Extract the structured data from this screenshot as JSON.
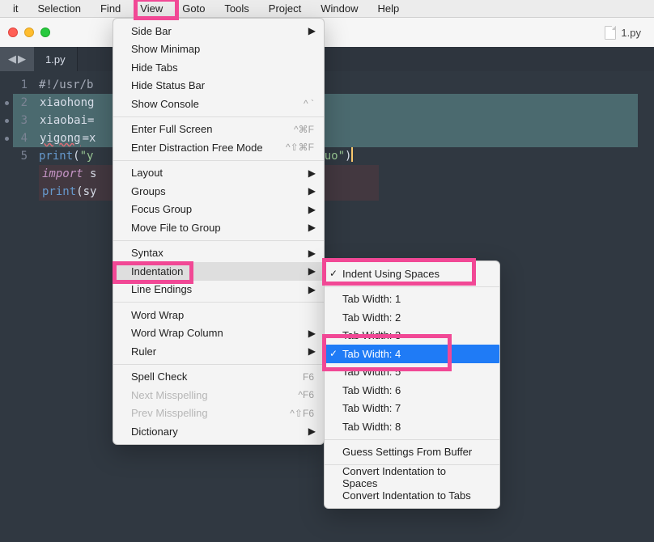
{
  "menubar": {
    "items": [
      "it",
      "Selection",
      "Find",
      "View",
      "Goto",
      "Tools",
      "Project",
      "Window",
      "Help"
    ]
  },
  "window": {
    "filename": "1.py",
    "tab_label": "1.py"
  },
  "editor": {
    "gutter": [
      "1",
      "2",
      "3",
      "4",
      "5"
    ],
    "lines": {
      "l1": "#!/usr/b",
      "l2": "xiaohong",
      "l3": "xiaobai=",
      "l4_a": "yigong",
      "l4_b": "=x",
      "l5_fn": "print",
      "l5_open": "(",
      "l5_str_a": "\"y",
      "l5_str_b": "ngguo\"",
      "l5_close": ")",
      "l6_kw": "import",
      "l6_rest": " s",
      "l7_fn": "print",
      "l7_open": "(",
      "l7_id": "sy"
    }
  },
  "view_menu": {
    "side_bar": "Side Bar",
    "show_minimap": "Show Minimap",
    "hide_tabs": "Hide Tabs",
    "hide_status_bar": "Hide Status Bar",
    "show_console": "Show Console",
    "show_console_kbd": "^ `",
    "enter_full": "Enter Full Screen",
    "enter_full_kbd": "^⌘F",
    "enter_distraction": "Enter Distraction Free Mode",
    "enter_distraction_kbd": "^⇧⌘F",
    "layout": "Layout",
    "groups": "Groups",
    "focus_group": "Focus Group",
    "move_file": "Move File to Group",
    "syntax": "Syntax",
    "indentation": "Indentation",
    "line_endings": "Line Endings",
    "word_wrap": "Word Wrap",
    "word_wrap_col": "Word Wrap Column",
    "ruler": "Ruler",
    "spell_check": "Spell Check",
    "spell_check_kbd": "F6",
    "next_misspell": "Next Misspelling",
    "next_misspell_kbd": "^F6",
    "prev_misspell": "Prev Misspelling",
    "prev_misspell_kbd": "^⇧F6",
    "dictionary": "Dictionary"
  },
  "indent_menu": {
    "indent_spaces": "Indent Using Spaces",
    "tw1": "Tab Width: 1",
    "tw2": "Tab Width: 2",
    "tw3": "Tab Width: 3",
    "tw4": "Tab Width: 4",
    "tw5": "Tab Width: 5",
    "tw6": "Tab Width: 6",
    "tw7": "Tab Width: 7",
    "tw8": "Tab Width: 8",
    "guess": "Guess Settings From Buffer",
    "conv_spaces": "Convert Indentation to Spaces",
    "conv_tabs": "Convert Indentation to Tabs"
  }
}
